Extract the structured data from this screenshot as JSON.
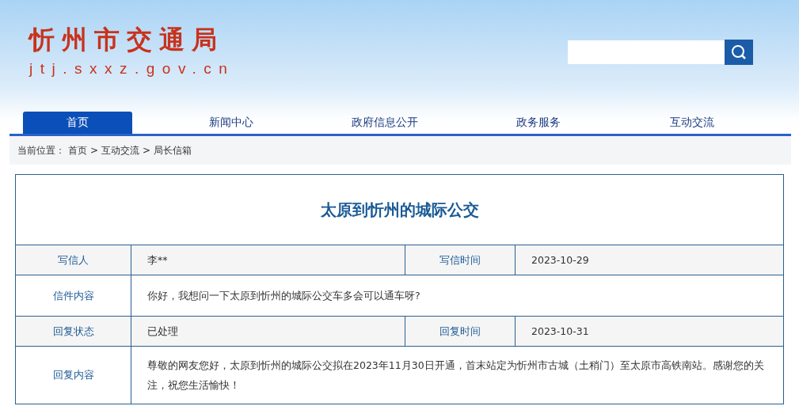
{
  "site": {
    "title": "忻州市交通局",
    "domain": "jtj.sxxz.gov.cn"
  },
  "nav": [
    {
      "label": "首页",
      "selected": true
    },
    {
      "label": "新闻中心",
      "selected": false
    },
    {
      "label": "政府信息公开",
      "selected": false
    },
    {
      "label": "政务服务",
      "selected": false
    },
    {
      "label": "互动交流",
      "selected": false
    }
  ],
  "breadcrumb": {
    "prefix": "当前位置：",
    "items": [
      "首页",
      "互动交流",
      "局长信箱"
    ],
    "separator": ">"
  },
  "letter": {
    "title": "太原到忻州的城际公交",
    "rows": [
      {
        "fields": [
          {
            "label": "写信人",
            "value": "李**"
          },
          {
            "label": "写信时间",
            "value": "2023-10-29"
          }
        ]
      },
      {
        "fields": [
          {
            "label": "信件内容",
            "value": "你好，我想问一下太原到忻州的城际公交车多会可以通车呀?"
          }
        ]
      },
      {
        "fields": [
          {
            "label": "回复状态",
            "value": "已处理"
          },
          {
            "label": "回复时间",
            "value": "2023-10-31"
          }
        ]
      },
      {
        "fields": [
          {
            "label": "回复内容",
            "value": "尊敬的网友您好，太原到忻州的城际公交拟在2023年11月30日开通，首末站定为忻州市古城（土稍门）至太原市高铁南站。感谢您的关注，祝您生活愉快！"
          }
        ]
      }
    ]
  }
}
